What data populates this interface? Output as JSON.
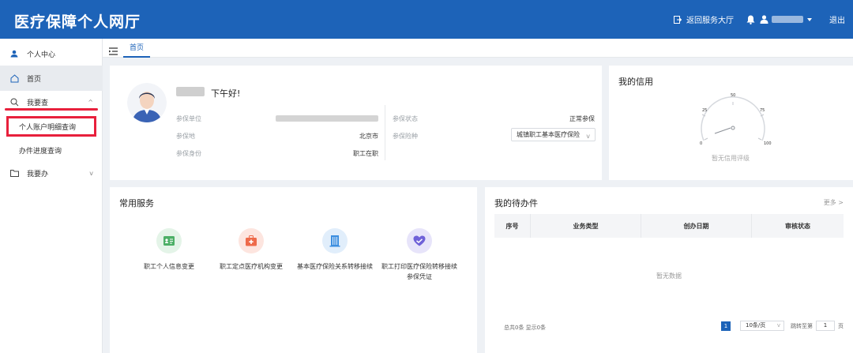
{
  "header": {
    "title": "医疗保障个人网厅",
    "return_label": "返回服务大厅",
    "logout_label": "退出"
  },
  "sidebar": {
    "personal_center": "个人中心",
    "home": "首页",
    "query_group": "我要查",
    "query_items": [
      "个人账户明细查询",
      "办件进度查询"
    ],
    "handle_group": "我要办"
  },
  "tabs": {
    "home": "首页"
  },
  "profile": {
    "greeting": "下午好!",
    "fields": {
      "unit_label": "参保单位",
      "place_label": "参保地",
      "place_value": "北京市",
      "identity_label": "参保身份",
      "identity_value": "职工在职",
      "status_label": "参保状态",
      "status_value": "正常参保",
      "type_label": "参保险种",
      "type_value": "城镇职工基本医疗保险"
    }
  },
  "credit": {
    "title": "我的信用",
    "ticks": [
      "0",
      "25",
      "50",
      "75",
      "100"
    ],
    "value": 0,
    "empty_text": "暂无信用评级"
  },
  "services": {
    "title": "常用服务",
    "items": [
      {
        "label": "职工个人信息变更",
        "icon": "id-card-icon",
        "color": "#4caf66",
        "bg": "#e4f4e8"
      },
      {
        "label": "职工定点医疗机构变更",
        "icon": "medical-kit-icon",
        "color": "#ee6a4a",
        "bg": "#fde5df"
      },
      {
        "label": "基本医疗保险关系转移接续",
        "icon": "building-icon",
        "color": "#3d8fe0",
        "bg": "#e1eefb"
      },
      {
        "label": "职工打印医疗保险转移接续参保凭证",
        "icon": "heart-icon",
        "color": "#6f61d8",
        "bg": "#e7e4fa"
      }
    ]
  },
  "todo": {
    "title": "我的待办件",
    "more": "更多 >",
    "columns": [
      "序号",
      "业务类型",
      "创办日期",
      "审核状态"
    ],
    "empty_text": "暂无数据",
    "summary": "总共0条 显示0条",
    "current_page": "1",
    "page_size": "10条/页",
    "goto_label": "跳转至第",
    "goto_value": "1",
    "page_unit": "页"
  }
}
